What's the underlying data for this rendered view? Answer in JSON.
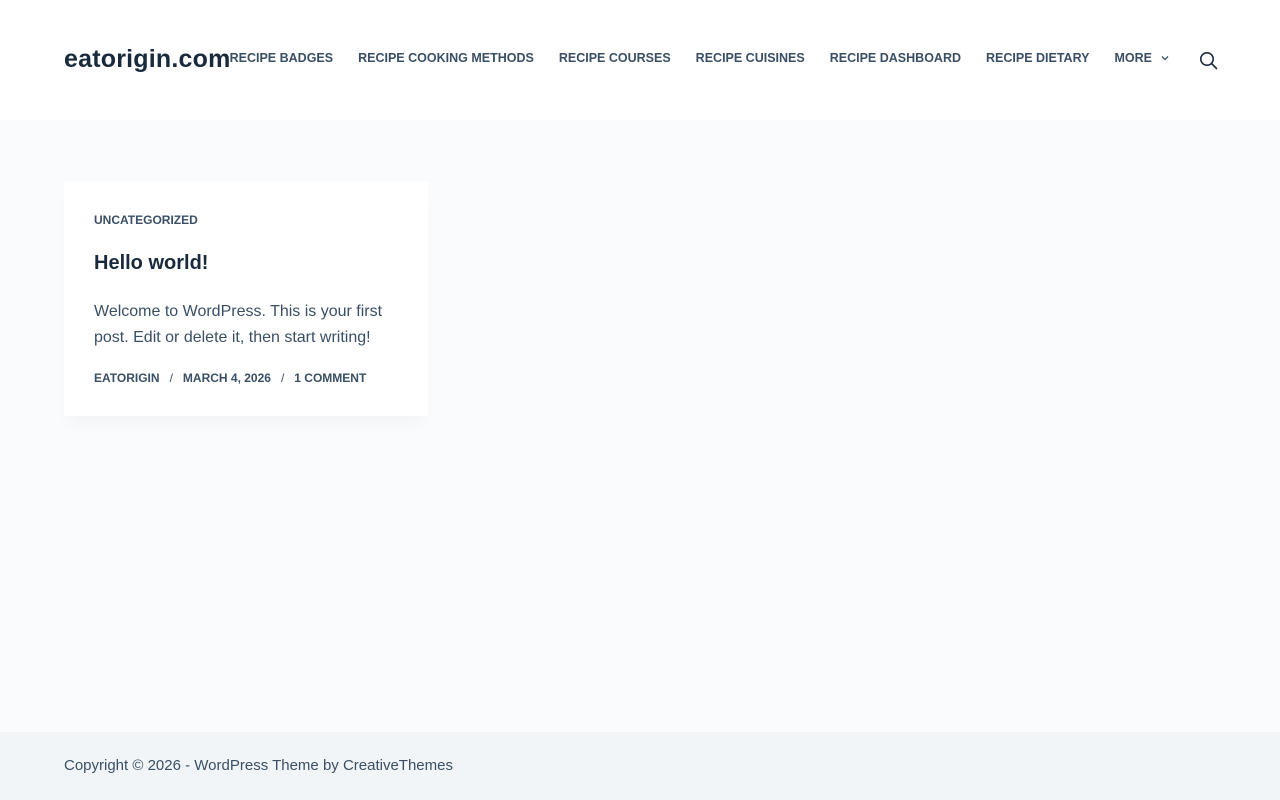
{
  "header": {
    "site_title": "eatorigin.com",
    "nav": [
      {
        "label": "RECIPE BADGES"
      },
      {
        "label": "RECIPE COOKING METHODS"
      },
      {
        "label": "RECIPE COURSES"
      },
      {
        "label": "RECIPE CUISINES"
      },
      {
        "label": "RECIPE DASHBOARD"
      },
      {
        "label": "RECIPE DIETARY"
      },
      {
        "label": "MORE"
      }
    ],
    "search_icon": "search-icon"
  },
  "post": {
    "category": "UNCATEGORIZED",
    "title": "Hello world!",
    "excerpt": "Welcome to WordPress. This is your first post. Edit or delete it, then start writing!",
    "author": "EATORIGIN",
    "date": "MARCH 4, 2026",
    "comments": "1 COMMENT",
    "separator": "/"
  },
  "footer": {
    "copyright": "Copyright © 2026 - WordPress Theme by CreativeThemes"
  },
  "colors": {
    "page_bg": "#f9fbfc",
    "header_bg": "#ffffff",
    "footer_bg": "#f2f5f7",
    "heading": "#192a3d",
    "text": "#3a4f66"
  }
}
